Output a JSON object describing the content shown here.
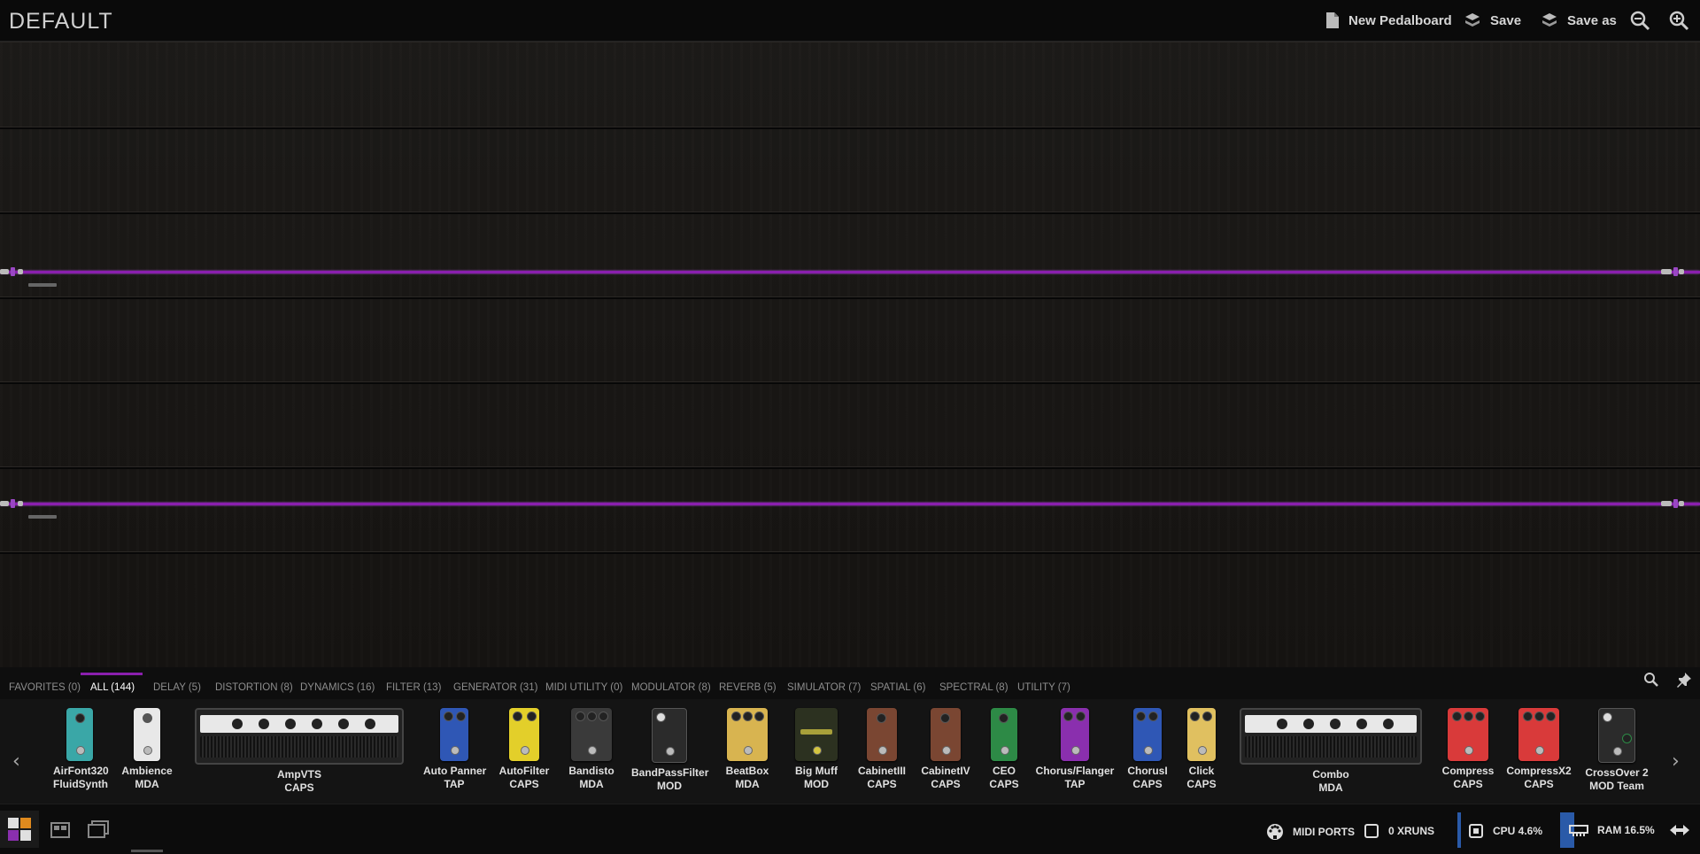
{
  "header": {
    "title": "DEFAULT",
    "new_pedalboard": "New Pedalboard",
    "save": "Save",
    "save_as": "Save as"
  },
  "tabs": [
    {
      "label": "FAVORITES (0)"
    },
    {
      "label": "ALL (144)",
      "active": true
    },
    {
      "label": "DELAY (5)"
    },
    {
      "label": "DISTORTION (8)"
    },
    {
      "label": "DYNAMICS (16)"
    },
    {
      "label": "FILTER (13)"
    },
    {
      "label": "GENERATOR (31)"
    },
    {
      "label": "MIDI UTILITY (0)"
    },
    {
      "label": "MODULATOR (8)"
    },
    {
      "label": "REVERB (5)"
    },
    {
      "label": "SIMULATOR (7)"
    },
    {
      "label": "SPATIAL (6)"
    },
    {
      "label": "SPECTRAL (8)"
    },
    {
      "label": "UTILITY (7)"
    }
  ],
  "plugins": [
    {
      "name": "AirFont320",
      "brand": "FluidSynth",
      "color": "#3aa7a7"
    },
    {
      "name": "Ambience",
      "brand": "MDA",
      "color": "#e8e8e8"
    },
    {
      "name": "AmpVTS",
      "brand": "CAPS",
      "color": "#222222"
    },
    {
      "name": "Auto Panner",
      "brand": "TAP",
      "color": "#2f57b5"
    },
    {
      "name": "AutoFilter",
      "brand": "CAPS",
      "color": "#e3cf2a"
    },
    {
      "name": "Bandisto",
      "brand": "MDA",
      "color": "#3a3a3a"
    },
    {
      "name": "BandPassFilter",
      "brand": "MOD",
      "color": "#2b2b2b"
    },
    {
      "name": "BeatBox",
      "brand": "MDA",
      "color": "#d8b450"
    },
    {
      "name": "Big Muff",
      "brand": "MOD",
      "color": "#2c3120"
    },
    {
      "name": "CabinetIII",
      "brand": "CAPS",
      "color": "#7a4632"
    },
    {
      "name": "CabinetIV",
      "brand": "CAPS",
      "color": "#7a4632"
    },
    {
      "name": "CEO",
      "brand": "CAPS",
      "color": "#2d8a46"
    },
    {
      "name": "Chorus/Flanger",
      "brand": "TAP",
      "color": "#8a2fae"
    },
    {
      "name": "ChorusI",
      "brand": "CAPS",
      "color": "#2f57b5"
    },
    {
      "name": "Click",
      "brand": "CAPS",
      "color": "#e0c060"
    },
    {
      "name": "Combo",
      "brand": "MDA",
      "color": "#222222"
    },
    {
      "name": "Compress",
      "brand": "CAPS",
      "color": "#d93a3a"
    },
    {
      "name": "CompressX2",
      "brand": "CAPS",
      "color": "#d93a3a"
    },
    {
      "name": "CrossOver 2",
      "brand": "MOD Team",
      "color": "#2b2b2b"
    }
  ],
  "status": {
    "midi_ports": "MIDI PORTS",
    "xruns": "0 XRUNS",
    "cpu": "CPU 4.6%",
    "ram": "RAM 16.5%"
  },
  "colors": {
    "cable": "#8a1fae",
    "accent": "#8a1fae",
    "meter": "#2a5aa8"
  }
}
